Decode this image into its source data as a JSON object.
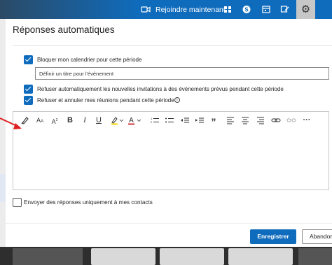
{
  "topbar": {
    "join_label": "Rejoindre maintenant",
    "icons": [
      "video-icon",
      "grid-icon",
      "skype-icon",
      "calendar-icon",
      "feedback-icon",
      "settings-gear-icon"
    ]
  },
  "dialog": {
    "title": "Réponses automatiques",
    "block_calendar": {
      "label": "Bloquer mon calendrier pour cette période",
      "checked": true
    },
    "event_title_input": {
      "value": "Définir un titre pour l'événement"
    },
    "decline_new": {
      "label": "Refuser automatiquement les nouvelles invitations à des événements prévus pendant cette période",
      "checked": true
    },
    "decline_cancel": {
      "label": "Refuser et annuler mes réunions pendant cette période",
      "checked": true
    },
    "editor_toolbar": {
      "tools": [
        "format-painter-icon",
        "font-size-icon",
        "superscript-icon",
        "bold-icon",
        "italic-icon",
        "underline-icon",
        "highlight-icon",
        "font-color-icon",
        "numbered-list-icon",
        "bullet-list-icon",
        "decrease-indent-icon",
        "increase-indent-icon",
        "quote-icon",
        "align-left-icon",
        "align-center-icon",
        "align-right-icon",
        "link-icon",
        "unlink-icon",
        "more-icon"
      ],
      "bold": "B",
      "italic": "I",
      "underline": "U",
      "font_color": "A",
      "quote": "”",
      "more": "···"
    },
    "contacts_only": {
      "label": "Envoyer des réponses uniquement à mes contacts",
      "checked": false
    },
    "save_label": "Enregistrer",
    "cancel_label": "Abandonner"
  },
  "colors": {
    "accent": "#0f6cbd",
    "arrow": "#e02020"
  }
}
